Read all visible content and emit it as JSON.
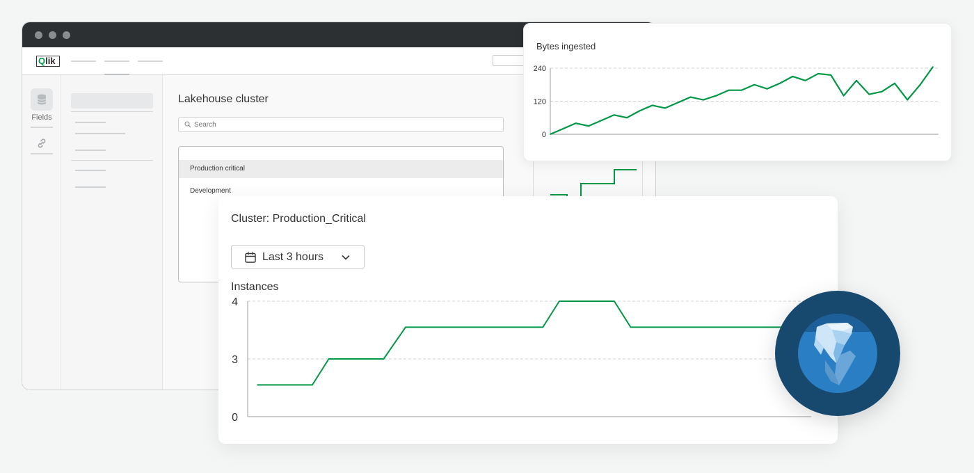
{
  "app": {
    "logo_text": "lik",
    "logo_mark": "Q",
    "rail": {
      "fields_label": "Fields"
    },
    "main": {
      "title": "Lakehouse cluster",
      "search_placeholder": "Search",
      "list_items": [
        {
          "label": "Production critical",
          "selected": true
        },
        {
          "label": "Development",
          "selected": false
        }
      ]
    }
  },
  "bytes_card": {
    "title": "Bytes ingested",
    "chart_data": {
      "type": "line",
      "title": "Bytes ingested",
      "ylim": [
        0,
        240
      ],
      "yticks": [
        0,
        120,
        240
      ],
      "grid": true,
      "color": "#009845",
      "values": [
        0,
        20,
        40,
        30,
        50,
        70,
        60,
        85,
        105,
        95,
        115,
        135,
        125,
        140,
        160,
        160,
        180,
        165,
        185,
        210,
        195,
        220,
        215,
        140,
        195,
        145,
        155,
        185,
        125,
        180,
        245
      ]
    }
  },
  "cluster_card": {
    "title": "Cluster: Production_Critical",
    "time_range": "Last 3 hours",
    "chart_label": "Instances",
    "chart_data": {
      "type": "line",
      "title": "Instances",
      "ytick_labels": [
        "0",
        "3",
        "4"
      ],
      "ylim": [
        2,
        4
      ],
      "grid": true,
      "color": "#009845",
      "points": [
        [
          0,
          2.55
        ],
        [
          0.1,
          2.55
        ],
        [
          0.13,
          3.0
        ],
        [
          0.23,
          3.0
        ],
        [
          0.27,
          3.55
        ],
        [
          0.52,
          3.55
        ],
        [
          0.55,
          4.0
        ],
        [
          0.65,
          4.0
        ],
        [
          0.68,
          3.55
        ],
        [
          1.0,
          3.55
        ]
      ]
    }
  },
  "colors": {
    "accent_green": "#009845",
    "badge_outer": "#17496f",
    "badge_inner": "#2a7fc4",
    "titlebar": "#2d3033"
  },
  "icons": {
    "database": "database-icon",
    "link": "link-icon",
    "search": "search-icon",
    "calendar": "calendar-icon",
    "chevron": "chevron-down-icon",
    "badge": "iceberg-icon"
  }
}
